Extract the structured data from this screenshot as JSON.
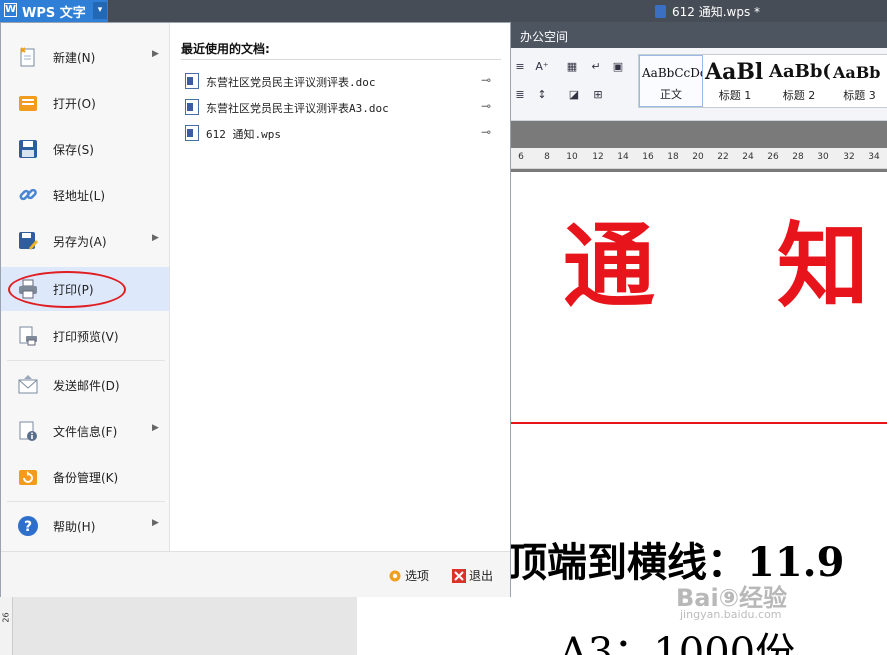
{
  "app": {
    "title": "WPS 文字",
    "dropdown_glyph": "▾"
  },
  "window": {
    "doc_title": "612 通知.wps *"
  },
  "ribbon": {
    "tab_office": "办公空间",
    "styles": [
      {
        "sample": "AaBbCcDd",
        "name": "正文"
      },
      {
        "sample": "AaBl",
        "name": "标题 1"
      },
      {
        "sample": "AaBb(",
        "name": "标题 2"
      },
      {
        "sample": "AaBb",
        "name": "标题 3"
      }
    ]
  },
  "ruler": {
    "ticks": [
      "6",
      "8",
      "10",
      "12",
      "14",
      "16",
      "18",
      "20",
      "22",
      "24",
      "26",
      "28",
      "30",
      "32",
      "34"
    ],
    "vertical_label": "26"
  },
  "menu": {
    "items": [
      {
        "label": "新建(N)",
        "icon": "new-doc-icon",
        "submenu": true
      },
      {
        "label": "打开(O)",
        "icon": "open-folder-icon",
        "submenu": false
      },
      {
        "label": "保存(S)",
        "icon": "save-disk-icon",
        "submenu": false
      },
      {
        "label": "轻地址(L)",
        "icon": "link-icon",
        "submenu": false
      },
      {
        "label": "另存为(A)",
        "icon": "save-as-icon",
        "submenu": true
      },
      {
        "label": "打印(P)",
        "icon": "printer-icon",
        "submenu": false,
        "highlighted": true
      },
      {
        "label": "打印预览(V)",
        "icon": "print-preview-icon",
        "submenu": false
      },
      {
        "label": "发送邮件(D)",
        "icon": "mail-icon",
        "submenu": false
      },
      {
        "label": "文件信息(F)",
        "icon": "file-info-icon",
        "submenu": true
      },
      {
        "label": "备份管理(K)",
        "icon": "backup-icon",
        "submenu": false
      },
      {
        "label": "帮助(H)",
        "icon": "help-icon",
        "submenu": true
      }
    ],
    "submenu_arrow": "▶",
    "recent_title": "最近使用的文档:",
    "recent": [
      {
        "name": "东营社区党员民主评议测评表.doc"
      },
      {
        "name": "东营社区党员民主评议测评表A3.doc"
      },
      {
        "name": "612 通知.wps"
      }
    ],
    "pin_glyph": "⊸",
    "options_label": "选项",
    "exit_label": "退出"
  },
  "document": {
    "heading_char1": "通",
    "heading_char2": "知",
    "line1": "顶端到横线：11.9",
    "line2": "A3：1000份"
  },
  "watermark": {
    "text": "Bai⑨经验",
    "sub": "jingyan.baidu.com"
  },
  "colors": {
    "accent": "#2f7fd6",
    "heading_red": "#e8141b",
    "highlight": "#dde8fb"
  }
}
